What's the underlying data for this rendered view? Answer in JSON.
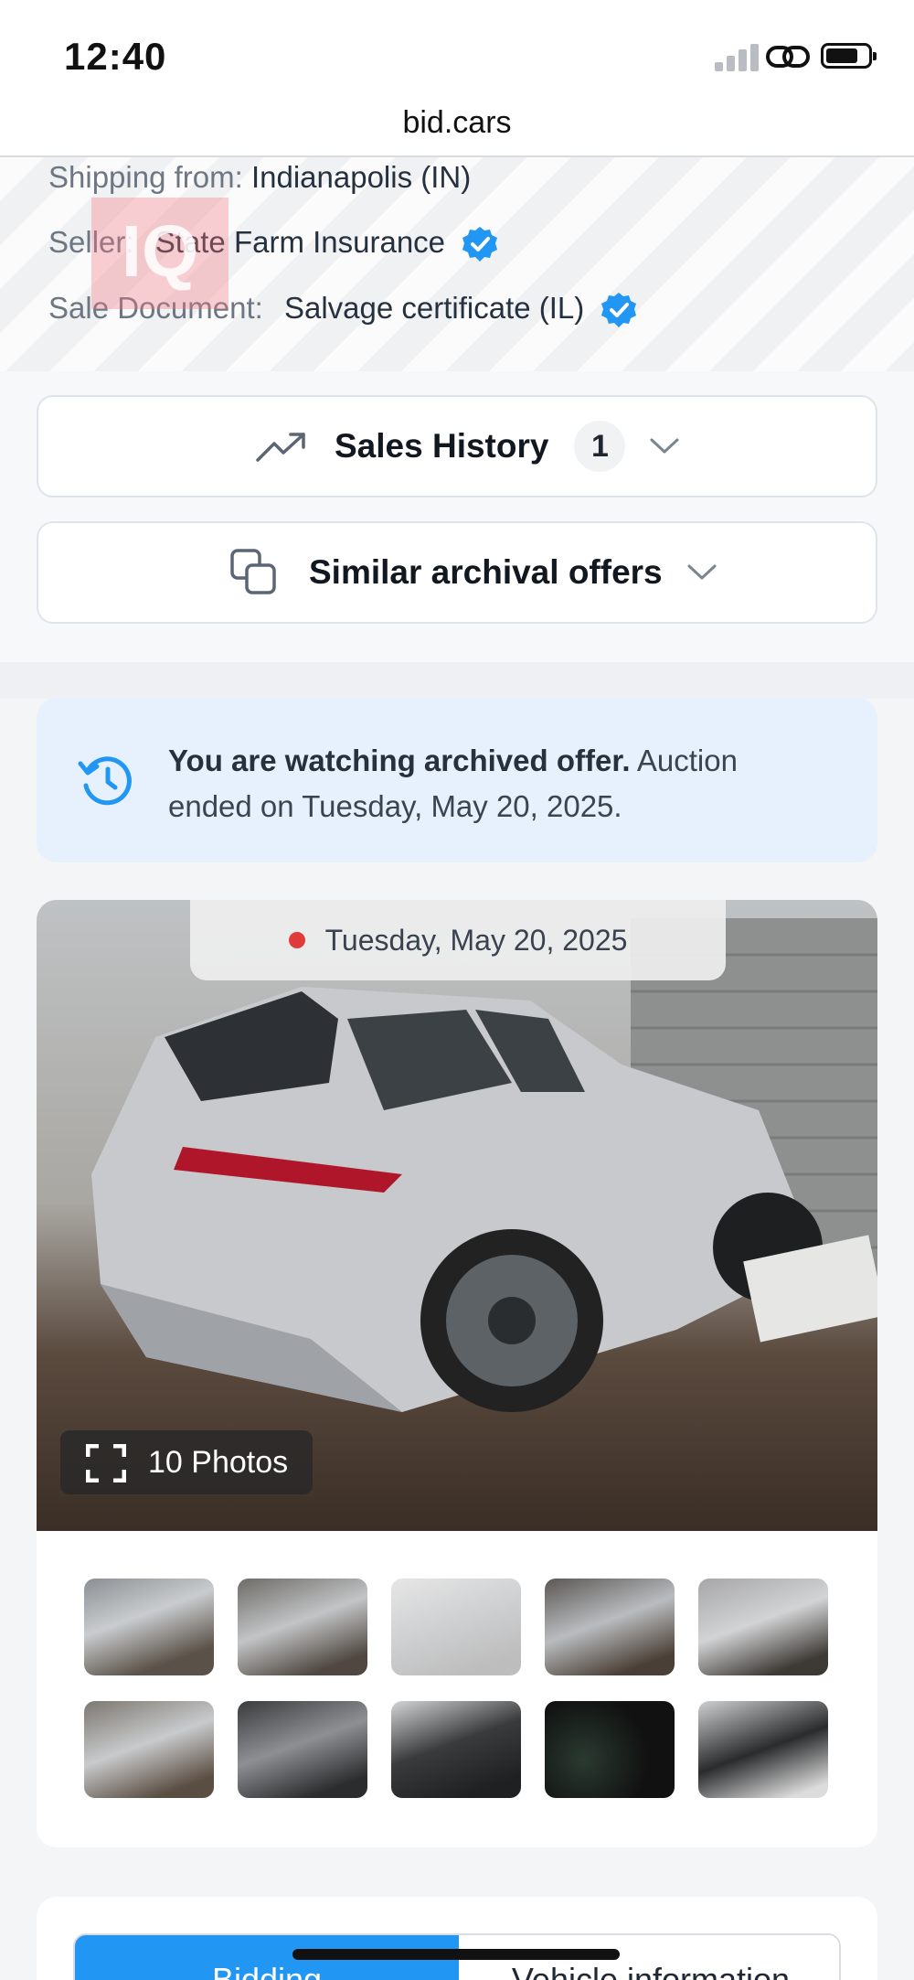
{
  "status_bar": {
    "time": "12:40"
  },
  "browser": {
    "url": "bid.cars"
  },
  "info": {
    "shipping_label": "Shipping from:",
    "shipping_value": "Indianapolis (IN)",
    "seller_label": "Seller:",
    "seller_value": "State Farm Insurance",
    "document_label": "Sale Document:",
    "document_value": "Salvage certificate (IL)",
    "watermark": "IQ"
  },
  "accordions": {
    "sales_history": {
      "title": "Sales History",
      "count": "1"
    },
    "similar": {
      "title": "Similar archival offers"
    }
  },
  "notice": {
    "bold": "You are watching archived offer.",
    "text": " Auction ended on Tuesday, May 20, 2025."
  },
  "gallery": {
    "date": "Tuesday, May 20, 2025",
    "photos_label": "10 Photos"
  },
  "tabs": {
    "bidding": "Bidding",
    "vehicle_info": "Vehicle information"
  },
  "colors": {
    "accent": "#2196f3",
    "verified": "#2196f3",
    "notice_bg": "#e6f1fd",
    "date_dot": "#e03a3a"
  }
}
